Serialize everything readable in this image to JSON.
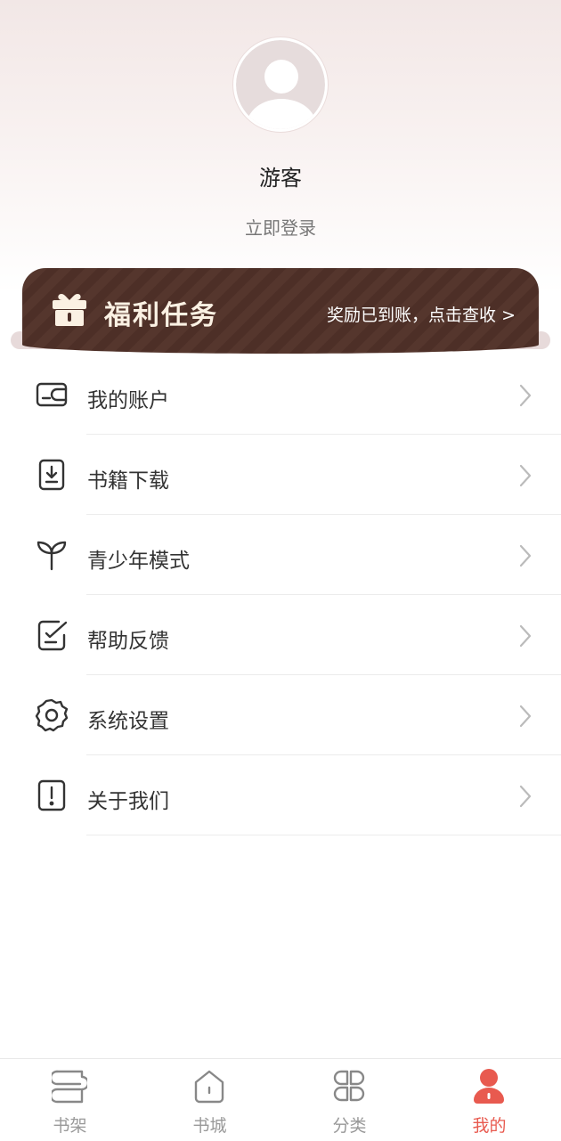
{
  "profile": {
    "username": "游客",
    "login_label": "立即登录"
  },
  "welfare": {
    "title": "福利任务",
    "subtitle": "奖励已到账，点击查收 >"
  },
  "menu": {
    "items": [
      {
        "label": "我的账户",
        "icon": "wallet-icon"
      },
      {
        "label": "书籍下载",
        "icon": "download-icon"
      },
      {
        "label": "青少年模式",
        "icon": "sprout-icon"
      },
      {
        "label": "帮助反馈",
        "icon": "feedback-icon"
      },
      {
        "label": "系统设置",
        "icon": "gear-icon"
      },
      {
        "label": "关于我们",
        "icon": "info-icon"
      }
    ]
  },
  "tabbar": {
    "items": [
      {
        "label": "书架",
        "icon": "bookshelf-icon"
      },
      {
        "label": "书城",
        "icon": "home-icon"
      },
      {
        "label": "分类",
        "icon": "category-icon"
      },
      {
        "label": "我的",
        "icon": "user-icon",
        "active": true
      }
    ]
  },
  "colors": {
    "accent": "#e85a4f",
    "banner": "#4d2f27",
    "banner_text": "#fbf1e3"
  }
}
